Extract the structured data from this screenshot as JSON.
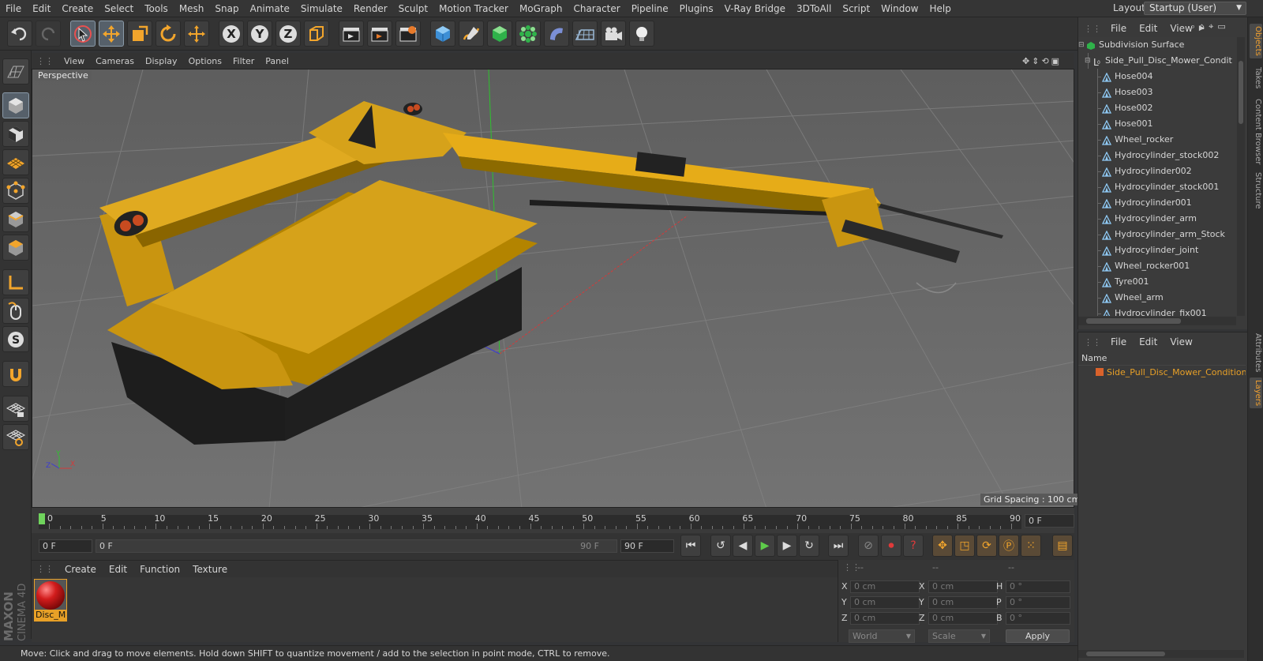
{
  "menubar": [
    "File",
    "Edit",
    "Create",
    "Select",
    "Tools",
    "Mesh",
    "Snap",
    "Animate",
    "Simulate",
    "Render",
    "Sculpt",
    "Motion Tracker",
    "MoGraph",
    "Character",
    "Pipeline",
    "Plugins",
    "V-Ray Bridge",
    "3DToAll",
    "Script",
    "Window",
    "Help"
  ],
  "layout": {
    "label": "Layout:",
    "value": "Startup (User)"
  },
  "viewport": {
    "menu": [
      "View",
      "Cameras",
      "Display",
      "Options",
      "Filter",
      "Panel"
    ],
    "label": "Perspective",
    "grid_spacing": "Grid Spacing : 100 cm",
    "axis": {
      "x": "X",
      "y": "Y",
      "z": "Z"
    }
  },
  "timeline": {
    "ticks": [
      "0",
      "5",
      "10",
      "15",
      "20",
      "25",
      "30",
      "35",
      "40",
      "45",
      "50",
      "55",
      "60",
      "65",
      "70",
      "75",
      "80",
      "85",
      "90"
    ],
    "end_frame": "0 F",
    "current": "0 F",
    "slider_start": "0 F",
    "slider_end": "90 F",
    "max": "90 F"
  },
  "materials": {
    "menu": [
      "Create",
      "Edit",
      "Function",
      "Texture"
    ],
    "items": [
      {
        "name": "Disc_Mc"
      }
    ]
  },
  "coords": {
    "headers": [
      "--",
      "--",
      "--"
    ],
    "rows": [
      {
        "l1": "X",
        "v1": "0 cm",
        "l2": "X",
        "v2": "0 cm",
        "l3": "H",
        "v3": "0 °"
      },
      {
        "l1": "Y",
        "v1": "0 cm",
        "l2": "Y",
        "v2": "0 cm",
        "l3": "P",
        "v3": "0 °"
      },
      {
        "l1": "Z",
        "v1": "0 cm",
        "l2": "Z",
        "v2": "0 cm",
        "l3": "B",
        "v3": "0 °"
      }
    ],
    "space": "World",
    "mode": "Scale",
    "apply": "Apply"
  },
  "status": "Move: Click and drag to move elements. Hold down SHIFT to quantize movement / add to the selection in point mode, CTRL to remove.",
  "brand": {
    "maxon": "MAXON",
    "product": "CINEMA 4D"
  },
  "objects": {
    "menu": [
      "File",
      "Edit",
      "View"
    ],
    "items": [
      {
        "name": "Subdivision Surface",
        "level": 0,
        "type": "subdiv"
      },
      {
        "name": "Side_Pull_Disc_Mower_Condit",
        "level": 1,
        "type": "null"
      },
      {
        "name": "Hose004",
        "level": 2,
        "type": "poly"
      },
      {
        "name": "Hose003",
        "level": 2,
        "type": "poly"
      },
      {
        "name": "Hose002",
        "level": 2,
        "type": "poly"
      },
      {
        "name": "Hose001",
        "level": 2,
        "type": "poly"
      },
      {
        "name": "Wheel_rocker",
        "level": 2,
        "type": "poly"
      },
      {
        "name": "Hydrocylinder_stock002",
        "level": 2,
        "type": "poly"
      },
      {
        "name": "Hydrocylinder002",
        "level": 2,
        "type": "poly"
      },
      {
        "name": "Hydrocylinder_stock001",
        "level": 2,
        "type": "poly"
      },
      {
        "name": "Hydrocylinder001",
        "level": 2,
        "type": "poly"
      },
      {
        "name": "Hydrocylinder_arm",
        "level": 2,
        "type": "poly"
      },
      {
        "name": "Hydrocylinder_arm_Stock",
        "level": 2,
        "type": "poly"
      },
      {
        "name": "Hydrocylinder_joint",
        "level": 2,
        "type": "poly"
      },
      {
        "name": "Wheel_rocker001",
        "level": 2,
        "type": "poly"
      },
      {
        "name": "Tyre001",
        "level": 2,
        "type": "poly"
      },
      {
        "name": "Wheel_arm",
        "level": 2,
        "type": "poly"
      },
      {
        "name": "Hydrocylinder_fix001",
        "level": 2,
        "type": "poly"
      }
    ]
  },
  "layers": {
    "menu": [
      "File",
      "Edit",
      "View"
    ],
    "header": "Name",
    "items": [
      {
        "name": "Side_Pull_Disc_Mower_Conditioner",
        "color": "#d9622b"
      }
    ]
  },
  "right_tabs": [
    "Objects",
    "Takes",
    "Content Browser",
    "Structure",
    "Attributes",
    "Layers"
  ]
}
